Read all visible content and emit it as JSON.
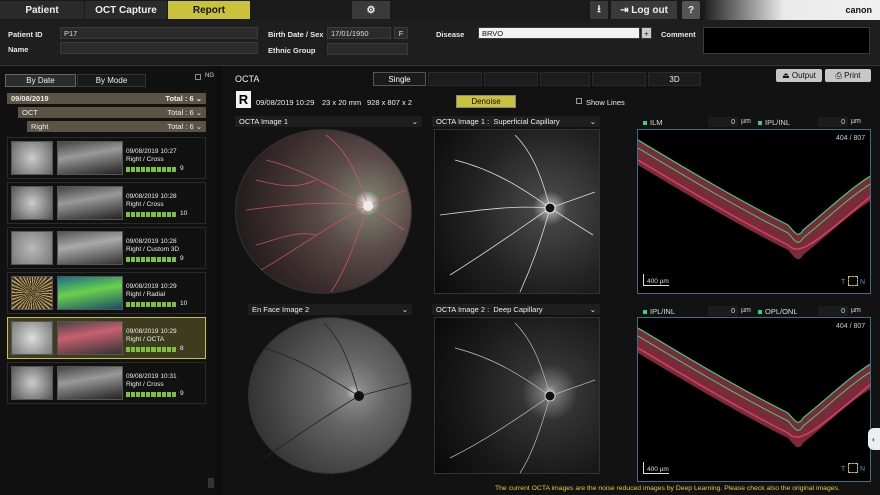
{
  "tabs": {
    "patient": "Patient",
    "oct": "OCT Capture",
    "report": "Report"
  },
  "topbar": {
    "logout": "Log out",
    "brand": "canon",
    "settings_icon": "gear-icon",
    "download_icon": "download-icon",
    "help": "?"
  },
  "info": {
    "pid_label": "Patient ID",
    "pid": "P17",
    "name_label": "Name",
    "name": "",
    "birth_label": "Birth Date / Sex",
    "birth": "17/01/1950",
    "sex": "F",
    "ethnic_label": "Ethnic Group",
    "ethnic": "",
    "disease_label": "Disease",
    "disease": "BRVO",
    "comment_label": "Comment",
    "comment": ""
  },
  "left": {
    "bydate": "By Date",
    "bymode": "By Mode",
    "ng": "NG",
    "date": "09/08/2019",
    "oct": "OCT",
    "right": "Right",
    "total": "Total : 6",
    "rows": [
      {
        "dt": "09/08/2019 10:27",
        "mode": "Right / Cross",
        "q": "9"
      },
      {
        "dt": "09/08/2019 10:28",
        "mode": "Right / Cross",
        "q": "10"
      },
      {
        "dt": "09/08/2019 10:28",
        "mode": "Right / Custom 3D",
        "q": "9"
      },
      {
        "dt": "09/08/2019 10:29",
        "mode": "Right / Radial",
        "q": "10"
      },
      {
        "dt": "09/08/2019 10:29",
        "mode": "Right / OCTA",
        "q": "8"
      },
      {
        "dt": "09/08/2019 10:31",
        "mode": "Right / Cross",
        "q": "9"
      }
    ]
  },
  "main": {
    "octa": "OCTA",
    "tab_single": "Single",
    "tab_3d": "3D",
    "output": "Output",
    "print": "Print",
    "eye": "R",
    "scan_dt": "09/08/2019  10:29",
    "area": "23 x 20 mm",
    "res": "928 x 807 x 2",
    "denoise": "Denoise",
    "showlines": "Show Lines",
    "p1": "OCTA Image 1",
    "p2_a": "OCTA Image 1 :",
    "p2_b": "Superficial Capillary",
    "p3": "En Face Image 2",
    "p4_a": "OCTA Image 2 :",
    "p4_b": "Deep Capillary",
    "b1_l": "ILM",
    "b1_r": "IPL/INL",
    "b2_l": "IPL/INL",
    "b2_r": "OPL/ONL",
    "zero": "0",
    "um": "µm",
    "slice": "404 / 807",
    "scale": "400 µm",
    "tn": "T",
    "tnn": "N",
    "footer": "The current OCTA images are the noise reduced images by Deep Learning. Please check also the original images."
  }
}
